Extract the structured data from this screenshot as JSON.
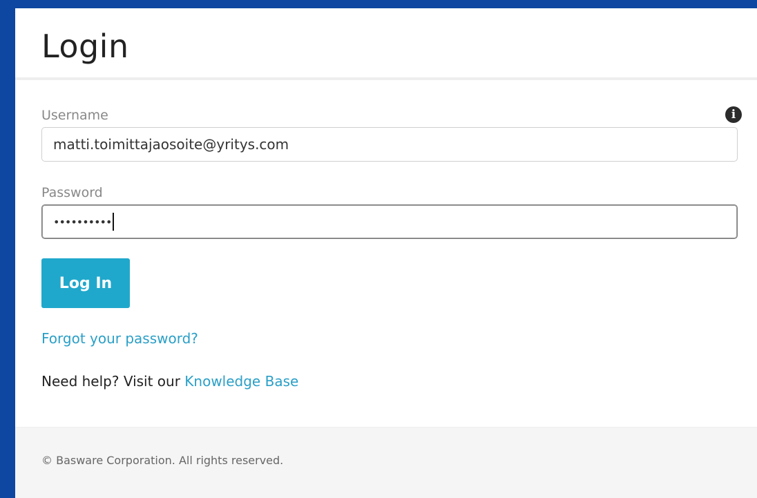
{
  "header": {
    "title": "Login"
  },
  "form": {
    "username_label": "Username",
    "username_value": "matti.toimittajaosoite@yritys.com",
    "password_label": "Password",
    "password_mask": "••••••••••",
    "info_icon": "info-circle-icon",
    "login_label": "Log In"
  },
  "links": {
    "forgot_password": "Forgot your password?",
    "help_prefix": "Need help? Visit our ",
    "knowledge_base": "Knowledge Base"
  },
  "footer": {
    "copyright": "© Basware Corporation. All rights reserved."
  },
  "colors": {
    "background": "#0d47a1",
    "primary_button": "#20a8cc",
    "link": "#2a9fc7"
  }
}
